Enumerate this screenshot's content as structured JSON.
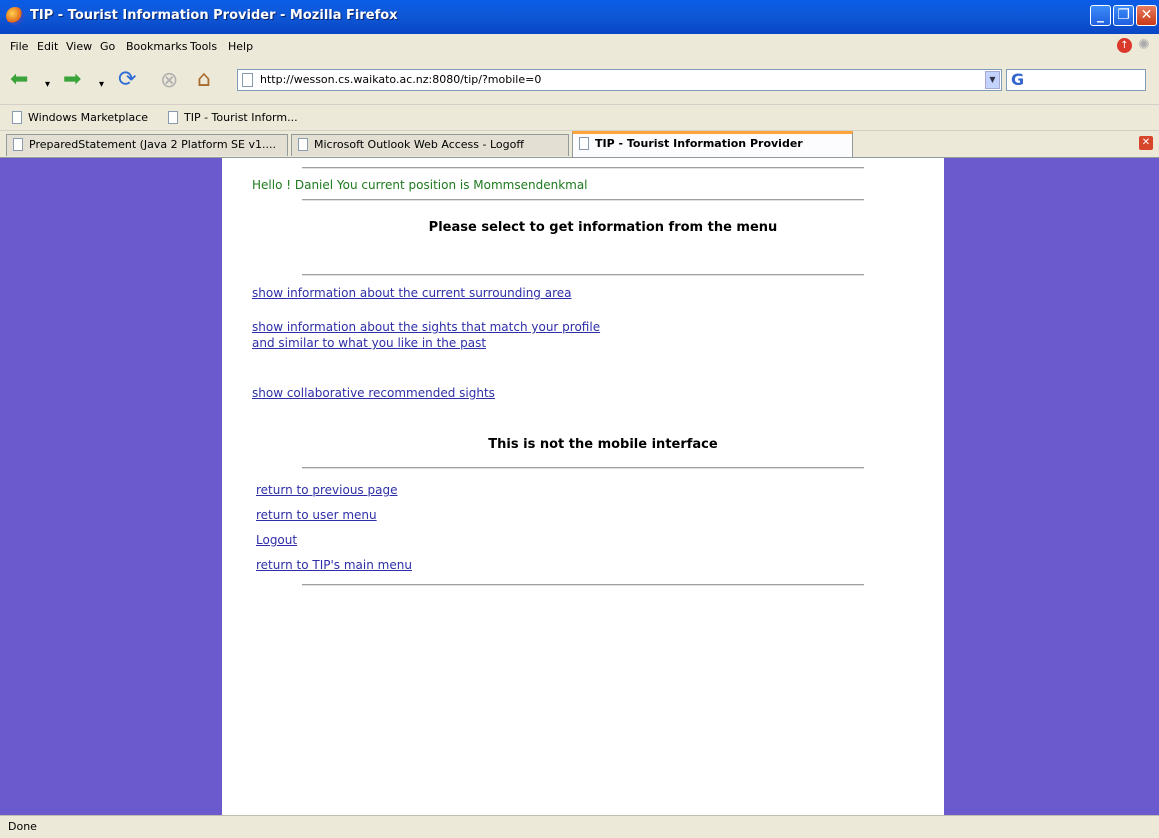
{
  "window": {
    "title": "TIP - Tourist Information Provider - Mozilla Firefox"
  },
  "menu": [
    "File",
    "Edit",
    "View",
    "Go",
    "Bookmarks",
    "Tools",
    "Help"
  ],
  "nav": {
    "url": "http://wesson.cs.waikato.ac.nz:8080/tip/?mobile=0"
  },
  "bookmarks": [
    "Windows Marketplace",
    "TIP - Tourist Inform..."
  ],
  "tabs": [
    {
      "label": "PreparedStatement (Java 2 Platform SE v1...."
    },
    {
      "label": "Microsoft Outlook Web Access - Logoff"
    },
    {
      "label": "TIP - Tourist Information Provider"
    }
  ],
  "page": {
    "greeting": "Hello ! Daniel You current position is Mommsendenkmal",
    "heading_select": "Please select to get information from the menu",
    "link_surrounding": "show information about the current surrounding area",
    "link_profile_line1": "show information about the sights that match your profile",
    "link_profile_line2": "and similar to what you like in the past",
    "link_collaborative": "show collaborative recommended sights",
    "heading_mobile": "This is not the mobile interface",
    "link_prev": "return to previous page",
    "link_usermenu": "return to user menu",
    "link_logout": "Logout",
    "link_mainmenu": "return to TIP's main menu"
  },
  "status": {
    "text": "Done"
  },
  "colors": {
    "page_bg": "#6a5acd",
    "link": "#2e2ea8",
    "greeting": "#1e7a1e",
    "active_tab_accent": "#ffa43a"
  }
}
